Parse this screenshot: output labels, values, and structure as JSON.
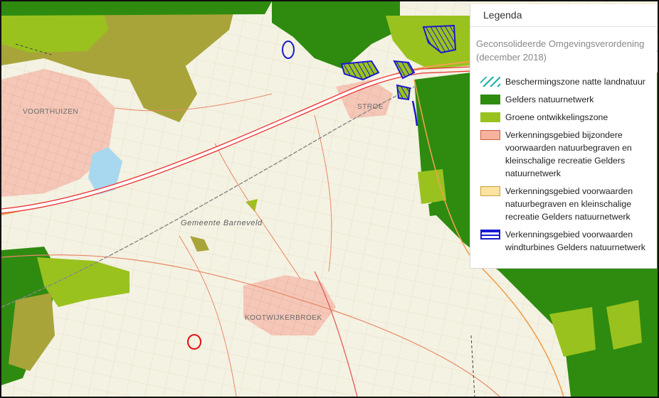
{
  "legend": {
    "title": "Legenda",
    "subtitle": "Geconsolideerde Omgevingsverordening (december 2018)",
    "items": [
      {
        "label": "Beschermingszone natte landnatuur",
        "swatch": "hatch-cyan",
        "color": "#20b2aa"
      },
      {
        "label": "Gelders natuurnetwerk",
        "swatch": "fill",
        "color": "#2e8b10"
      },
      {
        "label": "Groene ontwikkelingszone",
        "swatch": "fill",
        "color": "#9ac21e"
      },
      {
        "label": "Verkenningsgebied bijzondere voorwaarden natuurbegraven en kleinschalige recreatie Gelders natuurnetwerk",
        "swatch": "fill-outline",
        "color": "#f7b29e",
        "outline": "#c86040"
      },
      {
        "label": "Verkenningsgebied voorwaarden natuurbegraven en kleinschalige recreatie Gelders natuurnetwerk",
        "swatch": "fill-outline",
        "color": "#fbe3a0",
        "outline": "#c8a040"
      },
      {
        "label": "Verkenningsgebied voorwaarden windturbines Gelders natuurnetwerk",
        "swatch": "hatch-blue",
        "color": "#1a1ad0"
      }
    ]
  },
  "map": {
    "places": [
      "VOORTHUIZEN",
      "STROE",
      "KOOTWIJKERBROEK"
    ],
    "municipality": "Gemeente  Barneveld",
    "colors": {
      "background": "#f4f2e2",
      "natuurnetwerk": "#2e8b10",
      "ontwikkelingszone": "#9ac21e",
      "olive": "#a8a43a",
      "urban": "#f4c7b8",
      "road_red": "#e05050",
      "road_orange": "#f0a050",
      "highway": "#e83030",
      "water": "#a8d8f0"
    }
  }
}
